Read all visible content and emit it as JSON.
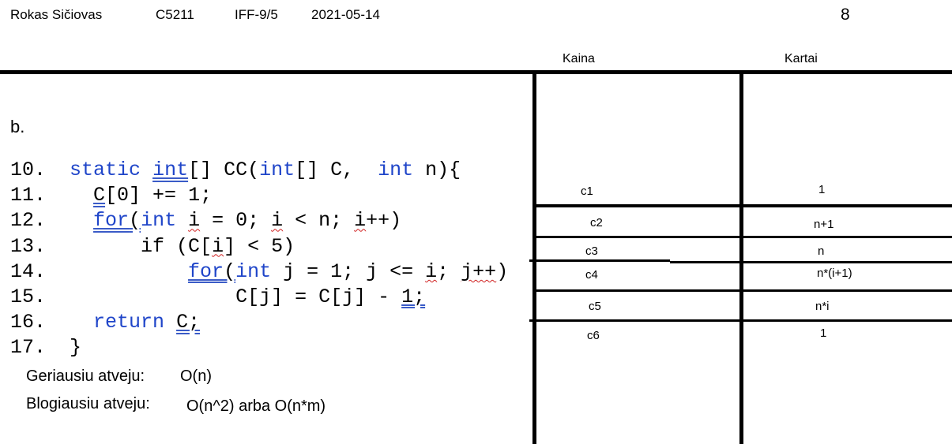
{
  "header": {
    "name": "Rokas Sičiovas",
    "code": "C5211",
    "group": "IFF-9/5",
    "date": "2021-05-14",
    "page_number": "8"
  },
  "columns": {
    "cost": "Kaina",
    "times": "Kartai"
  },
  "section_label": "b.",
  "code_lines": [
    "10.",
    "11.",
    "12.",
    "13.",
    "14.",
    "15.",
    "16.",
    "17."
  ],
  "code_text": {
    "l10_a": "static ",
    "l10_b": "int",
    "l10_c": "[] CC(",
    "l10_d": "int",
    "l10_e": "[] C,  ",
    "l10_f": "int",
    "l10_g": " n){",
    "l11_a": "C",
    "l11_b": "[0] += 1;",
    "l12_a": "for",
    "l12_b": "(",
    "l12_c": "int",
    "l12_d": " ",
    "l12_e": "i",
    "l12_f": " = 0; ",
    "l12_g": "i",
    "l12_h": " < n; ",
    "l12_i": "i",
    "l12_j": "++)",
    "l13_a": "if (C[",
    "l13_b": "i",
    "l13_c": "] < 5)",
    "l14_a": "for",
    "l14_b": "(",
    "l14_c": "int",
    "l14_d": " j = 1; j <= ",
    "l14_e": "i",
    "l14_f": "; ",
    "l14_g": "j++",
    "l14_h": ")",
    "l15_a": "C[j] = C[j] - ",
    "l15_b": "1;",
    "l16_a": "return ",
    "l16_b": "C;",
    "l17_a": "}"
  },
  "notes": {
    "best_label": "Geriausiu atveju:",
    "best_value": "O(n)",
    "worst_label": "Blogiausiu atveju:",
    "worst_value": "O(n^2) arba O(n*m)"
  },
  "table_rows": [
    {
      "cost": "c1",
      "times": "1"
    },
    {
      "cost": "c2",
      "times": "n+1"
    },
    {
      "cost": "c3",
      "times": "n"
    },
    {
      "cost": "c4",
      "times": "n*(i+1)"
    },
    {
      "cost": "c5",
      "times": "n*i"
    },
    {
      "cost": "c6",
      "times": "1"
    }
  ]
}
